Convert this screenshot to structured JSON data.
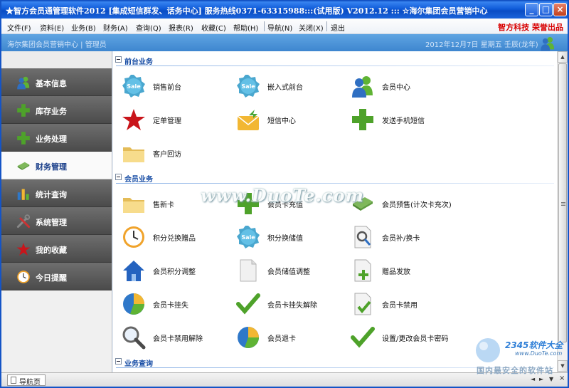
{
  "window": {
    "title": "★智方会员通管理软件2012 [集成短信群发、话务中心] 服务热线0371-63315988:::(试用版) V2012.12 ::: ☆海尔集团会员营销中心",
    "min_label": "_",
    "max_label": "□",
    "close_label": "×"
  },
  "menubar": {
    "items": [
      "文件(F)",
      "资料(E)",
      "业务(B)",
      "财务(A)",
      "查询(Q)",
      "报表(R)",
      "收藏(C)",
      "帮助(H)",
      "导航(N)",
      "关闭(X)",
      "退出"
    ],
    "brand": "智方科技  荣誉出品"
  },
  "header": {
    "left": "海尔集团会员营销中心 | 管理员",
    "right": "2012年12月7日  星期五  壬辰(龙年)"
  },
  "sidebar": {
    "items": [
      {
        "label": "基本信息",
        "icon": "users-icon"
      },
      {
        "label": "库存业务",
        "icon": "plus-icon"
      },
      {
        "label": "业务处理",
        "icon": "plus-icon"
      },
      {
        "label": "财务管理",
        "icon": "card-icon",
        "active": true
      },
      {
        "label": "统计查询",
        "icon": "bar-chart-icon"
      },
      {
        "label": "系统管理",
        "icon": "tools-icon"
      },
      {
        "label": "我的收藏",
        "icon": "star-icon"
      },
      {
        "label": "今日提醒",
        "icon": "clock-icon"
      }
    ]
  },
  "main": {
    "sections": [
      {
        "title": "前台业务"
      },
      {
        "title": "会员业务"
      },
      {
        "title": "业务查询"
      }
    ],
    "front_items": [
      {
        "label": "销售前台",
        "icon": "sale-badge-icon"
      },
      {
        "label": "嵌入式前台",
        "icon": "sale-badge-icon"
      },
      {
        "label": "会员中心",
        "icon": "users-icon"
      },
      {
        "label": "定单管理",
        "icon": "star-icon"
      },
      {
        "label": "短信中心",
        "icon": "envelope-icon"
      },
      {
        "label": "发送手机短信",
        "icon": "plus-icon"
      },
      {
        "label": "客户回访",
        "icon": "folder-icon"
      }
    ],
    "member_items": [
      {
        "label": "售新卡",
        "icon": "folder-icon"
      },
      {
        "label": "会员卡充值",
        "icon": "plus-icon"
      },
      {
        "label": "会员预售(计次卡充次)",
        "icon": "card-icon"
      },
      {
        "label": "积分兑换赠品",
        "icon": "clock-icon"
      },
      {
        "label": "积分换储值",
        "icon": "sale-badge-icon"
      },
      {
        "label": "会员补/换卡",
        "icon": "search-doc-icon"
      },
      {
        "label": "会员积分调整",
        "icon": "home-icon"
      },
      {
        "label": "会员储值调整",
        "icon": "document-icon"
      },
      {
        "label": "赠品发放",
        "icon": "doc-plus-icon"
      },
      {
        "label": "会员卡挂失",
        "icon": "pie-icon"
      },
      {
        "label": "会员卡挂失解除",
        "icon": "check-icon"
      },
      {
        "label": "会员卡禁用",
        "icon": "doc-check-icon"
      },
      {
        "label": "会员卡禁用解除",
        "icon": "magnifier-icon"
      },
      {
        "label": "会员退卡",
        "icon": "pie-icon"
      },
      {
        "label": "设置/更改会员卡密码",
        "icon": "check-icon"
      }
    ]
  },
  "statusbar": {
    "tab_label": "导航页",
    "prev": "◄",
    "next": "►",
    "drop": "▼",
    "close": "×"
  },
  "watermark": {
    "center": "www.DuoTe.com",
    "logo_line1": "2345软件大全",
    "logo_line2": "www.DuoTe.com",
    "logo_line3": "国内最安全的软件站"
  }
}
